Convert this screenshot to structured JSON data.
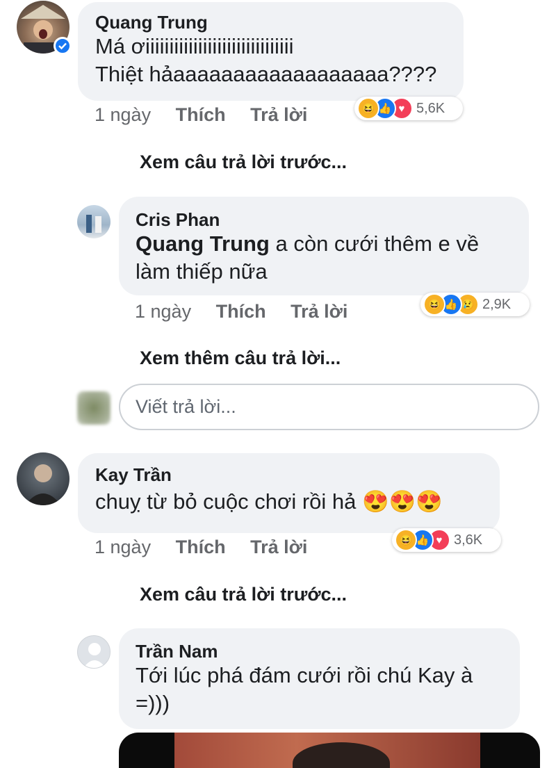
{
  "comment1": {
    "author": "Quang Trung",
    "line1": "Má ơiiiiiiiiiiiiiiiiiiiiiiiiiiiiiii",
    "line2": "Thiệt hảaaaaaaaaaaaaaaaaaa????",
    "time": "1 ngày",
    "like": "Thích",
    "reply": "Trả lời",
    "reaction_count": "5,6K",
    "reactions": [
      "haha-icon",
      "like-icon",
      "love-icon"
    ]
  },
  "comment1_prev_replies": "Xem câu trả lời trước...",
  "reply1": {
    "author": "Cris Phan",
    "mention": "Quang Trung",
    "text_after_mention": " a còn cưới thêm e về",
    "line2": "làm thiếp nữa",
    "time": "1 ngày",
    "like": "Thích",
    "reply": "Trả lời",
    "reaction_count": "2,9K",
    "reactions": [
      "haha-icon",
      "like-icon",
      "sad-icon"
    ]
  },
  "comment1_more_replies": "Xem thêm câu trả lời...",
  "reply_input": {
    "placeholder": "Viết trả lời..."
  },
  "comment2": {
    "author": "Kay Trần",
    "text": "chuỵ từ bỏ cuộc chơi rồi hả",
    "emojis": "😍😍😍",
    "time": "1 ngày",
    "like": "Thích",
    "reply": "Trả lời",
    "reaction_count": "3,6K",
    "reactions": [
      "haha-icon",
      "like-icon",
      "love-icon"
    ]
  },
  "comment2_prev_replies": "Xem câu trả lời trước...",
  "reply2": {
    "author": "Trần Nam",
    "line1": "Tới lúc phá đám cưới rồi chú Kay à",
    "line2": "=)))"
  },
  "colors": {
    "bubble": "#f0f2f5",
    "like_blue": "#1877f2",
    "love_red": "#f33e58",
    "haha_yellow": "#f7b125",
    "verified": "#1877f2"
  }
}
